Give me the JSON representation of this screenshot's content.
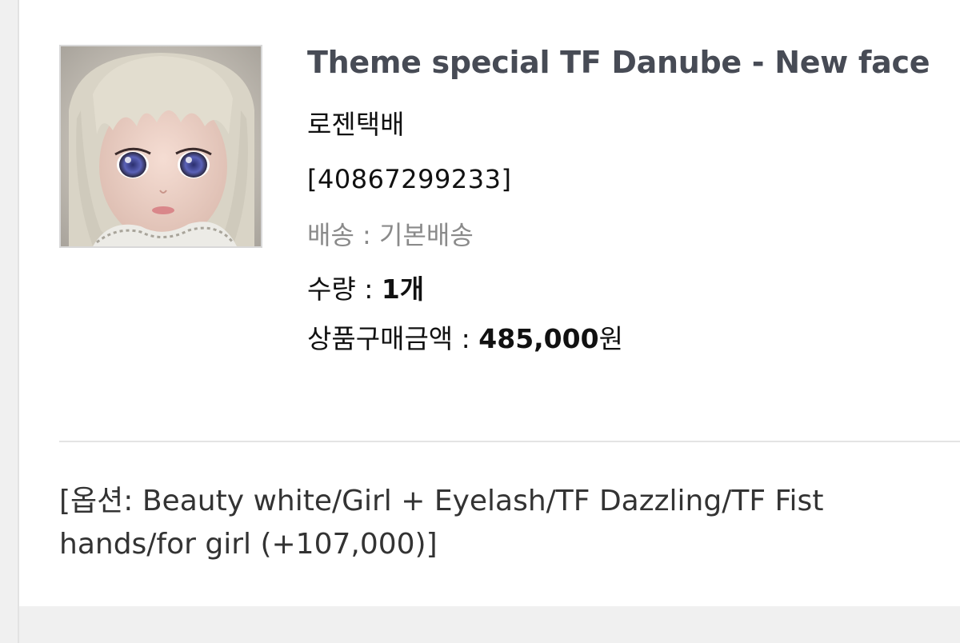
{
  "product": {
    "title": "Theme special TF Danube - New face",
    "courier": "로젠택배",
    "order_number": "[40867299233]",
    "shipping_label": "배송 : ",
    "shipping_value": "기본배송",
    "quantity_label": "수량 : ",
    "quantity_value": "1개",
    "amount_label": "상품구매금액 : ",
    "amount_value": "485,000",
    "amount_unit": "원",
    "option_text": "[옵션: Beauty white/Girl + Eyelash/TF Dazzling/TF Fist hands/for girl (+107,000)]"
  },
  "colors": {
    "title": "#474b55",
    "muted": "#8a8a8a",
    "background": "#f0f0f0",
    "card": "#ffffff"
  }
}
